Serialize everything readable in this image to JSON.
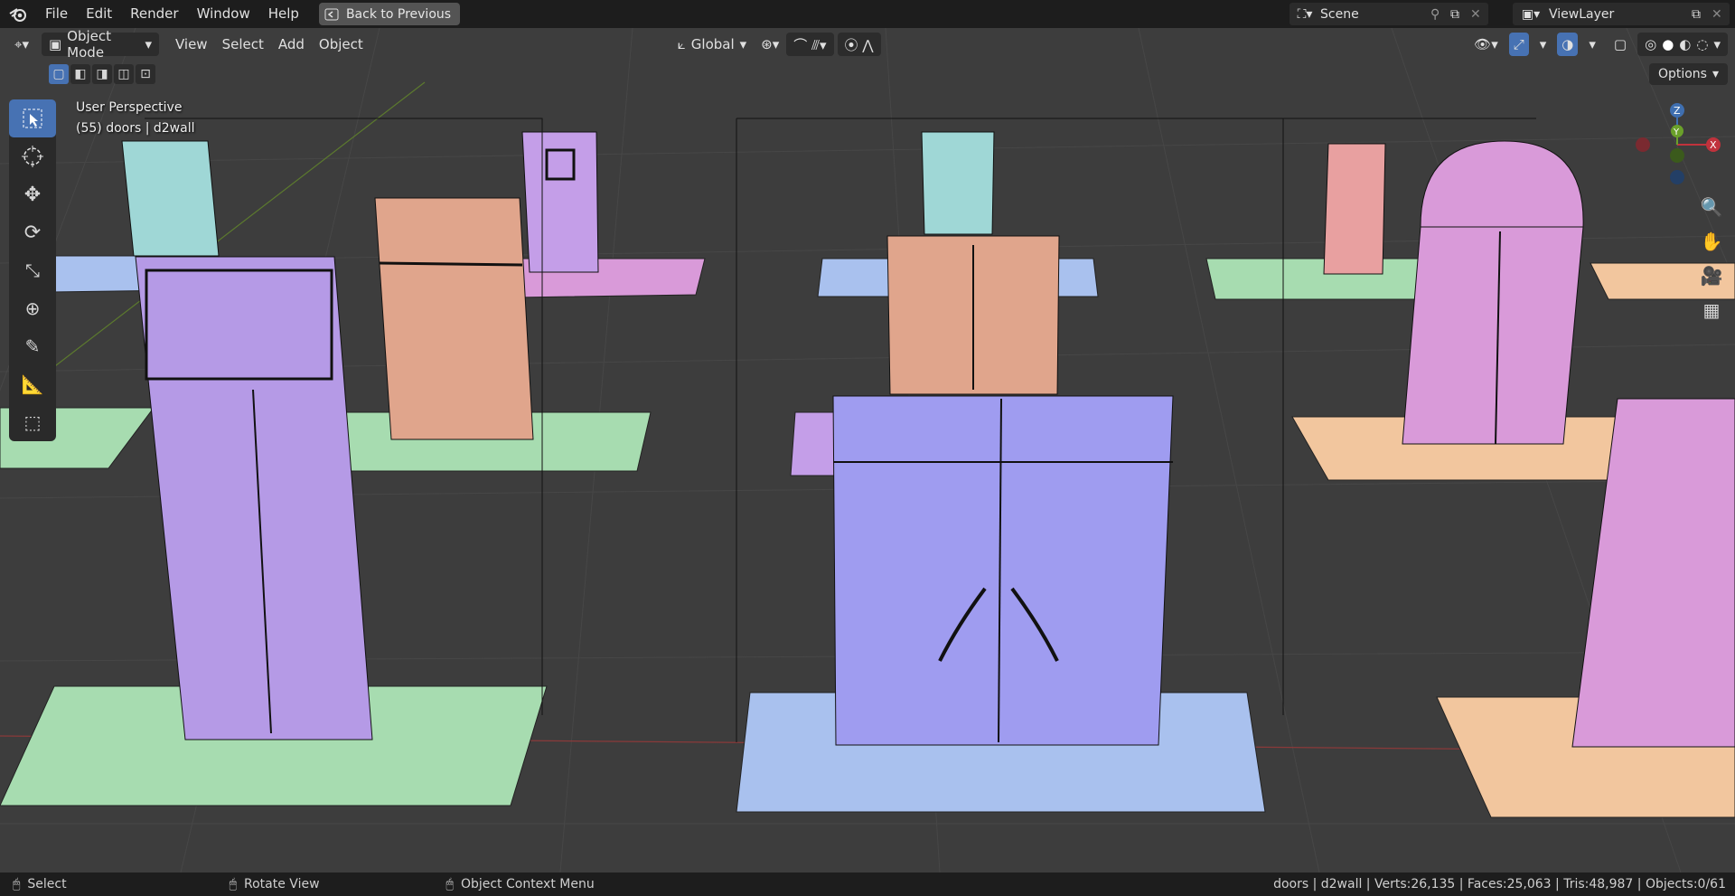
{
  "menu": {
    "items": [
      "File",
      "Edit",
      "Render",
      "Window",
      "Help"
    ],
    "back_label": "Back to Previous"
  },
  "scene": {
    "label": "Scene",
    "view_layer": "ViewLayer"
  },
  "header": {
    "mode": "Object Mode",
    "menus": [
      "View",
      "Select",
      "Add",
      "Object"
    ],
    "transform_orientation": "Global"
  },
  "viewport": {
    "perspective": "User Perspective",
    "collection_info": "(55) doors | d2wall",
    "options_label": "Options"
  },
  "gizmo": {
    "z": "Z",
    "y": "Y",
    "x": "X"
  },
  "status": {
    "select": "Select",
    "rotate": "Rotate View",
    "context": "Object Context Menu",
    "stats": "doors | d2wall | Verts:26,135 | Faces:25,063 | Tris:48,987 | Objects:0/61"
  },
  "colors": {
    "accent": "#4772b3",
    "purple": "#b59ae6",
    "green": "#a7dcb0",
    "salmon": "#e0a58c",
    "cyan": "#9fd7d6",
    "pink": "#d99ad9",
    "blue": "#a9c1ee",
    "peach": "#f2c69e"
  }
}
